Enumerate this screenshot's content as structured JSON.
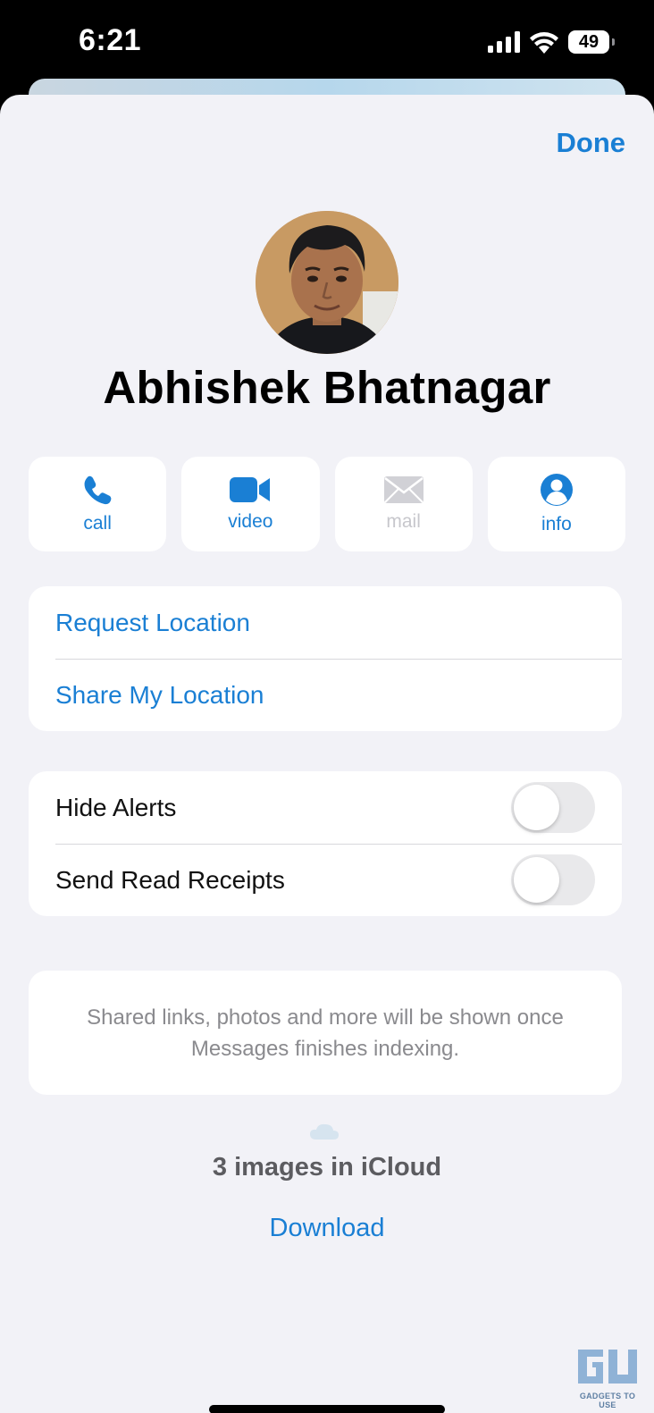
{
  "status_bar": {
    "time": "6:21",
    "battery": "49"
  },
  "header": {
    "done_label": "Done"
  },
  "contact": {
    "name": "Abhishek Bhatnagar"
  },
  "actions": [
    {
      "label": "call",
      "icon": "phone-icon",
      "enabled": true
    },
    {
      "label": "video",
      "icon": "video-camera-icon",
      "enabled": true
    },
    {
      "label": "mail",
      "icon": "envelope-icon",
      "enabled": false
    },
    {
      "label": "info",
      "icon": "person-circle-icon",
      "enabled": true
    }
  ],
  "location": {
    "request": "Request Location",
    "share": "Share My Location"
  },
  "settings": {
    "hide_alerts": {
      "label": "Hide Alerts",
      "on": false
    },
    "read_receipts": {
      "label": "Send Read Receipts",
      "on": false
    }
  },
  "info_text": "Shared links, photos and more will be shown once Messages finishes indexing.",
  "icloud": {
    "text": "3 images in iCloud",
    "download_label": "Download"
  },
  "watermark": {
    "text": "GADGETS TO USE"
  },
  "colors": {
    "accent": "#1a7fd4",
    "sheet_background": "#f2f2f7",
    "toggle_off": "#e9e9eb"
  }
}
